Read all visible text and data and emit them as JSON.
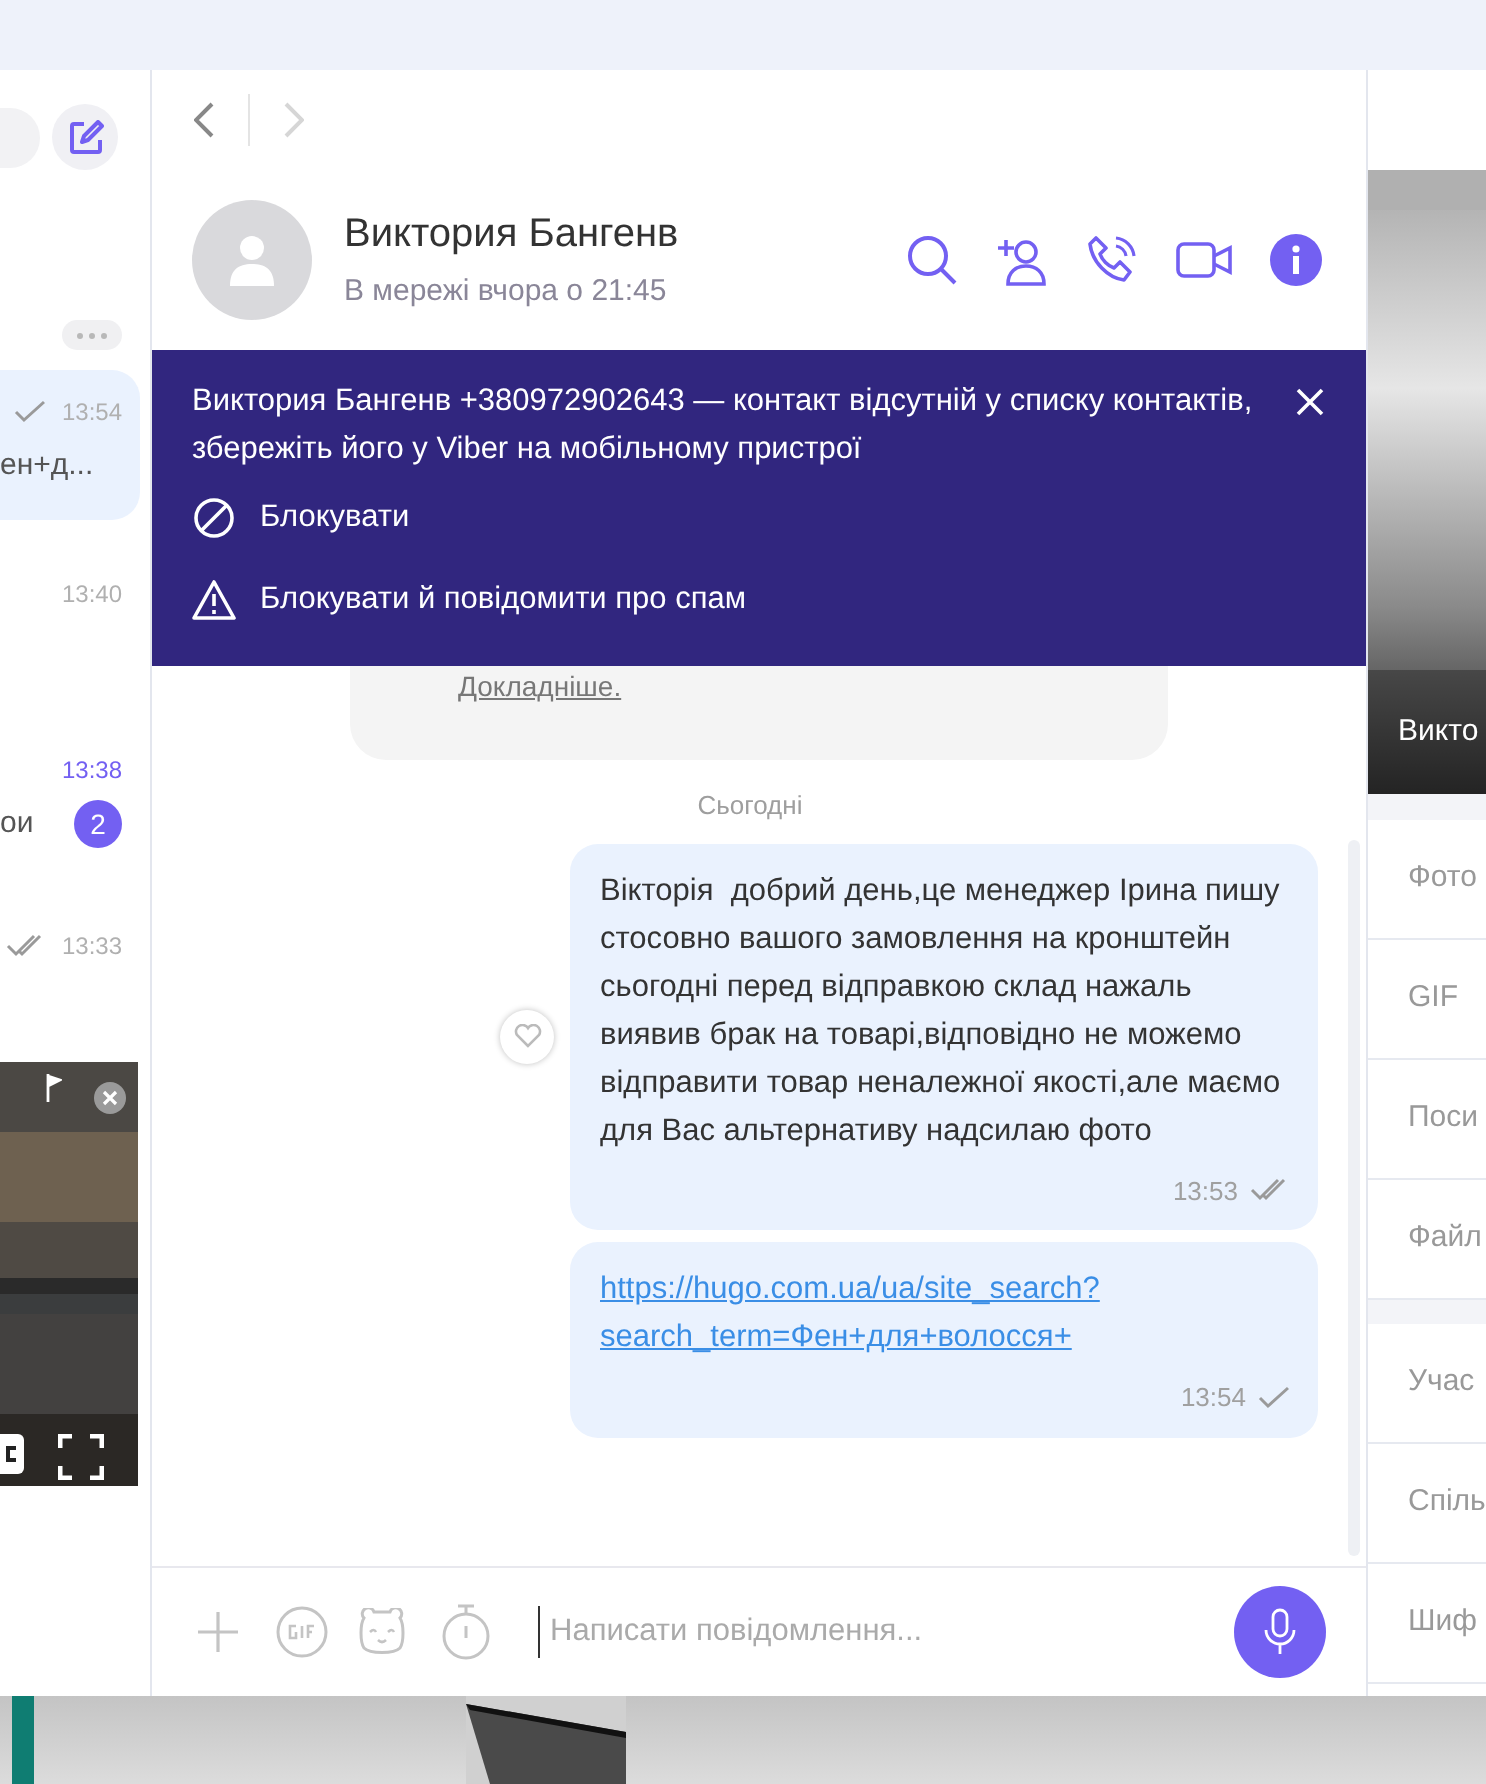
{
  "chat_list": {
    "rows": [
      {
        "time": "13:54",
        "preview": "ен+д...",
        "delivered": false,
        "selected": true
      },
      {
        "time": "13:40",
        "selected": false
      },
      {
        "time": "13:38",
        "preview": "ои",
        "unread": "2",
        "selected": false
      },
      {
        "time": "13:33",
        "delivered": true,
        "selected": false
      }
    ]
  },
  "conversation": {
    "nav": {
      "back_disabled": false,
      "forward_disabled": true
    },
    "contact": {
      "name": "Виктория Бангенв",
      "status": "В мережі вчора о 21:45"
    },
    "banner": {
      "text": "Виктория Бангенв +380972902643 — контакт відсутній у списку контактів, збережіть його у Viber на мобільному пристрої",
      "actions": [
        {
          "label": "Блокувати",
          "kind": "block"
        },
        {
          "label": "Блокувати й повідомити про спам",
          "kind": "spam"
        }
      ]
    },
    "info_card": {
      "link": "Докладніше."
    },
    "date_divider": "Сьогодні",
    "messages": [
      {
        "kind": "text",
        "text": "Вікторія  добрий день,це менеджер Ірина пишу стосовно вашого замовлення на кронштейн  сьогодні перед відправкою склад нажаль виявив брак на товарі,відповідно не можемо відправити товар неналежної якості,але маємо для Вас альтернативу надсилаю фото",
        "time": "13:53",
        "delivered": true,
        "like_button": true
      },
      {
        "kind": "link",
        "lines": [
          "https://hugo.com.ua/ua/site_search?",
          "search_term=Фен+для+волосся+"
        ],
        "time": "13:54",
        "delivered": false,
        "like_button": false
      }
    ],
    "composer": {
      "placeholder": "Написати повідомлення..."
    }
  },
  "details_panel": {
    "name": "Викто",
    "sections": [
      {
        "items": [
          {
            "label": "Фото"
          },
          {
            "label": "GIF"
          },
          {
            "label": "Поси"
          },
          {
            "label": "Файл"
          }
        ]
      },
      {
        "items": [
          {
            "label": "Учас"
          },
          {
            "label": "Спіль"
          },
          {
            "label": "Шиф"
          }
        ]
      }
    ]
  }
}
